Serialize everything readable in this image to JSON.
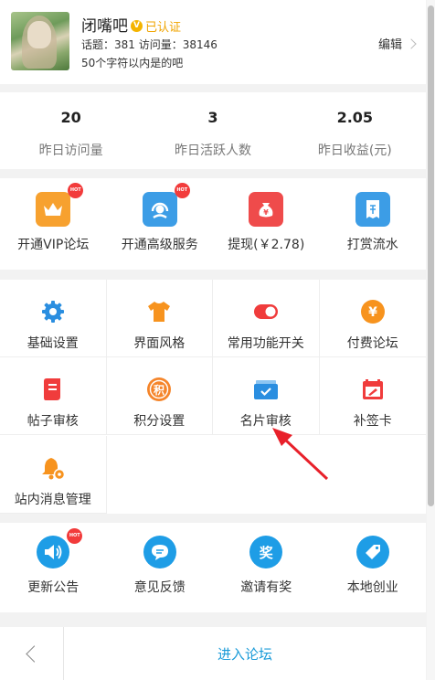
{
  "header": {
    "forum_name": "闭嘴吧",
    "verified_label": "已认证",
    "stats_line": "话题：381 访问量：38146",
    "description": "50个字符以内是的吧",
    "edit_label": "编辑"
  },
  "stats": [
    {
      "value": "20",
      "label": "昨日访问量"
    },
    {
      "value": "3",
      "label": "昨日活跃人数"
    },
    {
      "value": "2.05",
      "label": "昨日收益(元)"
    }
  ],
  "features": [
    {
      "label": "开通VIP论坛",
      "icon": "crown-icon",
      "color": "#f7a12f",
      "hot": true
    },
    {
      "label": "开通高级服务",
      "icon": "headset-icon",
      "color": "#3c9de6",
      "hot": true
    },
    {
      "label": "提现(￥2.78)",
      "icon": "money-bag-icon",
      "color": "#ef4b4b",
      "hot": false
    },
    {
      "label": "打赏流水",
      "icon": "receipt-icon",
      "color": "#3c9de6",
      "hot": false
    }
  ],
  "hot_badge": "HOT",
  "settings": [
    {
      "label": "基础设置",
      "icon": "gear-icon"
    },
    {
      "label": "界面风格",
      "icon": "tshirt-icon"
    },
    {
      "label": "常用功能开关",
      "icon": "toggle-icon"
    },
    {
      "label": "付费论坛",
      "icon": "yen-coin-icon"
    },
    {
      "label": "帖子审核",
      "icon": "document-icon"
    },
    {
      "label": "积分设置",
      "icon": "points-icon"
    },
    {
      "label": "名片审核",
      "icon": "card-check-icon"
    },
    {
      "label": "补签卡",
      "icon": "calendar-edit-icon"
    },
    {
      "label": "站内消息管理",
      "icon": "bell-settings-icon"
    }
  ],
  "tools": [
    {
      "label": "更新公告",
      "icon": "megaphone-icon",
      "hot": true
    },
    {
      "label": "意见反馈",
      "icon": "chat-icon",
      "hot": false
    },
    {
      "label": "邀请有奖",
      "icon": "prize-icon",
      "glyph": "奖",
      "hot": false
    },
    {
      "label": "本地创业",
      "icon": "tag-icon",
      "hot": false
    }
  ],
  "icon_glyphs": {
    "yen": "¥",
    "points": "积"
  },
  "bottom": {
    "enter_label": "进入论坛"
  },
  "colors": {
    "accent": "#1b9bd8",
    "hot": "#f23b3b",
    "verified": "#f0a400"
  }
}
